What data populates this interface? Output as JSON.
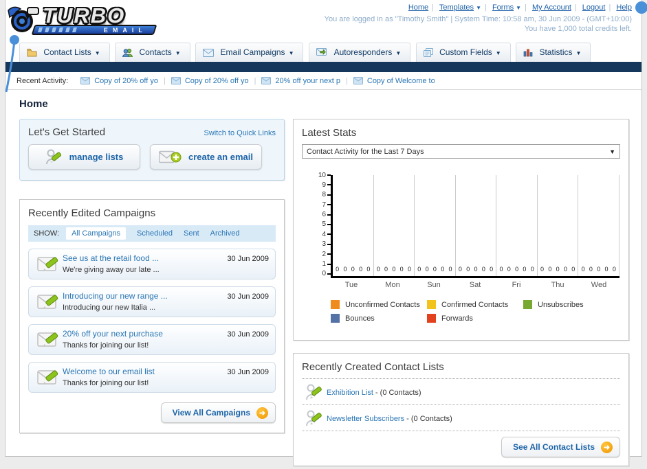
{
  "header": {
    "logo_title": "TURBO",
    "logo_subtitle": "EMAIL",
    "nav": {
      "home": "Home",
      "templates": "Templates",
      "forms": "Forms",
      "my_account": "My Account",
      "logout": "Logout",
      "help": "Help"
    },
    "login_line1": "You are logged in as \"Timothy Smith\" | System Time: 10:58 am, 30 Jun 2009 - (GMT+10:00)",
    "login_line2": "You have 1,000 total credits left."
  },
  "tabs": {
    "contact_lists": "Contact Lists",
    "contacts": "Contacts",
    "email_campaigns": "Email Campaigns",
    "autoresponders": "Autoresponders",
    "custom_fields": "Custom Fields",
    "statistics": "Statistics"
  },
  "recent_activity": {
    "label": "Recent Activity:",
    "items": [
      {
        "text": "Copy of 20% off yo"
      },
      {
        "text": "Copy of 20% off yo"
      },
      {
        "text": "20% off your next p"
      },
      {
        "text": "Copy of Welcome to"
      }
    ]
  },
  "page_title": "Home",
  "get_started": {
    "title": "Let's Get Started",
    "switch_link": "Switch to Quick Links",
    "manage_lists_label": "manage lists",
    "create_email_label": "create an email"
  },
  "campaigns": {
    "title": "Recently Edited Campaigns",
    "show_label": "SHOW:",
    "filters": {
      "all": "All Campaigns",
      "scheduled": "Scheduled",
      "sent": "Sent",
      "archived": "Archived"
    },
    "items": [
      {
        "title": "See us at the retail food ...",
        "subtitle": "We're giving away our late ...",
        "date": "30 Jun 2009"
      },
      {
        "title": "Introducing our new range ...",
        "subtitle": "Introducing our new Italia ...",
        "date": "30 Jun 2009"
      },
      {
        "title": "20% off your next purchase",
        "subtitle": "Thanks for joining our list!",
        "date": "30 Jun 2009"
      },
      {
        "title": "Welcome to our email list",
        "subtitle": "Thanks for joining our list!",
        "date": "30 Jun 2009"
      }
    ],
    "view_all_label": "View All Campaigns"
  },
  "stats": {
    "title": "Latest Stats",
    "dropdown_value": "Contact Activity for the Last 7 Days"
  },
  "chart_data": {
    "type": "bar",
    "title": "Contact Activity for the Last 7 Days",
    "categories": [
      "Tue",
      "Mon",
      "Sun",
      "Sat",
      "Fri",
      "Thu",
      "Wed"
    ],
    "series": [
      {
        "name": "Unconfirmed Contacts",
        "color": "#f08c1e",
        "values": [
          0,
          0,
          0,
          0,
          0,
          0,
          0
        ]
      },
      {
        "name": "Confirmed Contacts",
        "color": "#f2c31d",
        "values": [
          0,
          0,
          0,
          0,
          0,
          0,
          0
        ]
      },
      {
        "name": "Unsubscribes",
        "color": "#76a832",
        "values": [
          0,
          0,
          0,
          0,
          0,
          0,
          0
        ]
      },
      {
        "name": "Bounces",
        "color": "#5572a7",
        "values": [
          0,
          0,
          0,
          0,
          0,
          0,
          0
        ]
      },
      {
        "name": "Forwards",
        "color": "#e2431e",
        "values": [
          0,
          0,
          0,
          0,
          0,
          0,
          0
        ]
      }
    ],
    "ylim": [
      0,
      10
    ],
    "yticks": [
      0,
      1,
      2,
      3,
      4,
      5,
      6,
      7,
      8,
      9,
      10
    ],
    "xlabel": "",
    "ylabel": "",
    "grid": "vertical group separators",
    "legend_position": "bottom",
    "value_labels_shown": true
  },
  "contact_lists": {
    "title": "Recently Created Contact Lists",
    "items": [
      {
        "name": "Exhibition List",
        "suffix": " - (0 Contacts)"
      },
      {
        "name": "Newsletter Subscribers",
        "suffix": " - (0 Contacts)"
      }
    ],
    "see_all_label": "See All Contact Lists"
  }
}
